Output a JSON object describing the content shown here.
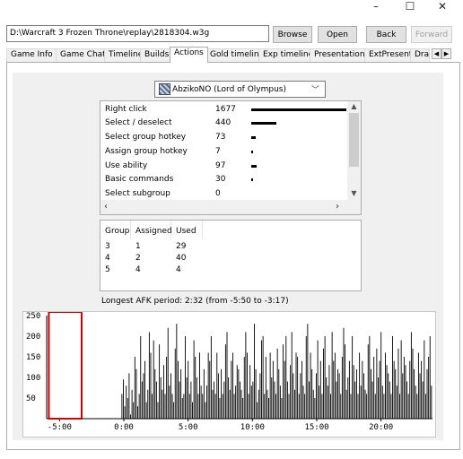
{
  "window": {
    "controls": {
      "minimize": "–",
      "maximize": "☐",
      "close": "✕"
    }
  },
  "toolbar": {
    "path_value": "D:\\Warcraft 3 Frozen Throne\\replay\\2818304.w3g",
    "browse_label": "Browse",
    "open_label": "Open",
    "back_label": "Back",
    "forward_label": "Forward"
  },
  "tabs": [
    {
      "label": "Game Info",
      "active": false
    },
    {
      "label": "Game Chat",
      "active": false
    },
    {
      "label": "Timeline",
      "active": false
    },
    {
      "label": "Builds",
      "active": false
    },
    {
      "label": "Actions",
      "active": true
    },
    {
      "label": "Gold timeline",
      "active": false
    },
    {
      "label": "Exp timeline",
      "active": false
    },
    {
      "label": "Presentation",
      "active": false
    },
    {
      "label": "ExtPresent",
      "active": false
    },
    {
      "label": "Dra",
      "active": false
    }
  ],
  "player_select": {
    "value": "AbzikoNO (Lord of Olympus)"
  },
  "actions": [
    {
      "name": "Right click",
      "count": "1677",
      "value": 1677
    },
    {
      "name": "Select / deselect",
      "count": "440",
      "value": 440
    },
    {
      "name": "Select group hotkey",
      "count": "73",
      "value": 73
    },
    {
      "name": "Assign group hotkey",
      "count": "7",
      "value": 7
    },
    {
      "name": "Use ability",
      "count": "97",
      "value": 97
    },
    {
      "name": "Basic commands",
      "count": "30",
      "value": 30
    },
    {
      "name": "Select subgroup",
      "count": "0",
      "value": 0
    }
  ],
  "groups": {
    "headers": [
      "Group",
      "Assigned",
      "Used"
    ],
    "rows": [
      [
        "3",
        "1",
        "29"
      ],
      [
        "4",
        "2",
        "40"
      ],
      [
        "5",
        "4",
        "4"
      ]
    ]
  },
  "afk_text": "Longest AFK period: 2:32 (from -5:50 to -3:17)",
  "colors": {
    "highlight": "#cc0000",
    "bar": "#000000"
  },
  "chart_data": {
    "type": "bar",
    "title": "",
    "xlabel": "",
    "ylabel": "",
    "ylim": [
      0,
      250
    ],
    "y_ticks": [
      "250",
      "200",
      "150",
      "100",
      "50"
    ],
    "x_ticks": [
      "-5:00",
      "0:00",
      "5:00",
      "10:00",
      "15:00",
      "20:00"
    ],
    "x_tick_minutes": [
      -5,
      0,
      5,
      10,
      15,
      20
    ],
    "xlim_minutes": [
      -6,
      24
    ],
    "afk_range_minutes": [
      -5.83,
      -3.28
    ],
    "series": [
      {
        "values": [
          0,
          0,
          0,
          0,
          0,
          0,
          0,
          0,
          0,
          0,
          0,
          0,
          0,
          0,
          0,
          0,
          0,
          0,
          0,
          0,
          0,
          0,
          0,
          0,
          0,
          0,
          0,
          0,
          0,
          0,
          0,
          0,
          0,
          0,
          0,
          0,
          0,
          0,
          0,
          0,
          0,
          0,
          0,
          0,
          0,
          0,
          0,
          0,
          0,
          0,
          0,
          0,
          60,
          95,
          30,
          80,
          50,
          110,
          10,
          70,
          40,
          150,
          120,
          30,
          60,
          200,
          90,
          110,
          140,
          40,
          70,
          210,
          160,
          60,
          190,
          120,
          90,
          40,
          180,
          100,
          70,
          130,
          60,
          150,
          220,
          80,
          110,
          60,
          40,
          170,
          230,
          140,
          90,
          120,
          50,
          60,
          200,
          100,
          140,
          60,
          90,
          40,
          190,
          150,
          100,
          60,
          160,
          80,
          60,
          120,
          40,
          80,
          160,
          140,
          200,
          70,
          90,
          60,
          160,
          110,
          50,
          120,
          60,
          90,
          180,
          210,
          100,
          70,
          140,
          160,
          60,
          80,
          130,
          120,
          90,
          70,
          50,
          150,
          210,
          160,
          60,
          130,
          80,
          90,
          230,
          120,
          40,
          70,
          110,
          190,
          200,
          60,
          150,
          70,
          50,
          160,
          100,
          140,
          90,
          60,
          170,
          120,
          80,
          50,
          180,
          140,
          200,
          90,
          60,
          130,
          210,
          110,
          70,
          160,
          150,
          60,
          110,
          140,
          80,
          60,
          200,
          230,
          90,
          160,
          120,
          70,
          50,
          110,
          190,
          80,
          140,
          60,
          170,
          200,
          100,
          80,
          130,
          60,
          210,
          140,
          160,
          90,
          120,
          110,
          60,
          150,
          220,
          180,
          70,
          100,
          140,
          60,
          200,
          130,
          90,
          120,
          60,
          160,
          80,
          140,
          110,
          70,
          60,
          180,
          200,
          120,
          90,
          150,
          60,
          170,
          100,
          140,
          210,
          80,
          60,
          160,
          130,
          110,
          90,
          60,
          200,
          140,
          120,
          80,
          170,
          60,
          190,
          110,
          150,
          130,
          90,
          60,
          140,
          210,
          170,
          120,
          80,
          60,
          160,
          110,
          140,
          90,
          190,
          60,
          120,
          150,
          200,
          80
        ]
      }
    ]
  }
}
